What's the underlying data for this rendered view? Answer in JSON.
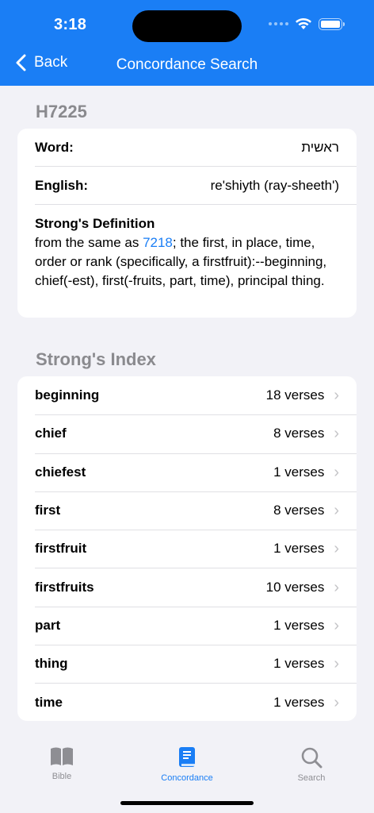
{
  "status": {
    "time": "3:18"
  },
  "nav": {
    "back_label": "Back",
    "title": "Concordance Search"
  },
  "entry": {
    "id": "H7225",
    "word_label": "Word:",
    "word_value": "ראשית",
    "english_label": "English:",
    "english_value": "re'shiyth (ray-sheeth')",
    "definition_title": "Strong's Definition",
    "definition_prefix": "from the same as ",
    "definition_link": "7218",
    "definition_suffix": "; the first, in place, time, order or rank (specifically, a firstfruit):--beginning, chief(-est), first(-fruits, part, time), principal thing."
  },
  "index": {
    "title": "Strong's Index",
    "items": [
      {
        "word": "beginning",
        "count": "18 verses"
      },
      {
        "word": "chief",
        "count": "8 verses"
      },
      {
        "word": "chiefest",
        "count": "1 verses"
      },
      {
        "word": "first",
        "count": "8 verses"
      },
      {
        "word": "firstfruit",
        "count": "1 verses"
      },
      {
        "word": "firstfruits",
        "count": "10 verses"
      },
      {
        "word": "part",
        "count": "1 verses"
      },
      {
        "word": "thing",
        "count": "1 verses"
      },
      {
        "word": "time",
        "count": "1 verses"
      }
    ]
  },
  "tabs": [
    {
      "label": "Bible",
      "icon": "book-icon",
      "active": false
    },
    {
      "label": "Concordance",
      "icon": "concordance-book-icon",
      "active": true
    },
    {
      "label": "Search",
      "icon": "search-icon",
      "active": false
    }
  ],
  "colors": {
    "accent": "#1a7ef5",
    "background": "#f2f2f7",
    "secondary_text": "#8a8a8e"
  }
}
